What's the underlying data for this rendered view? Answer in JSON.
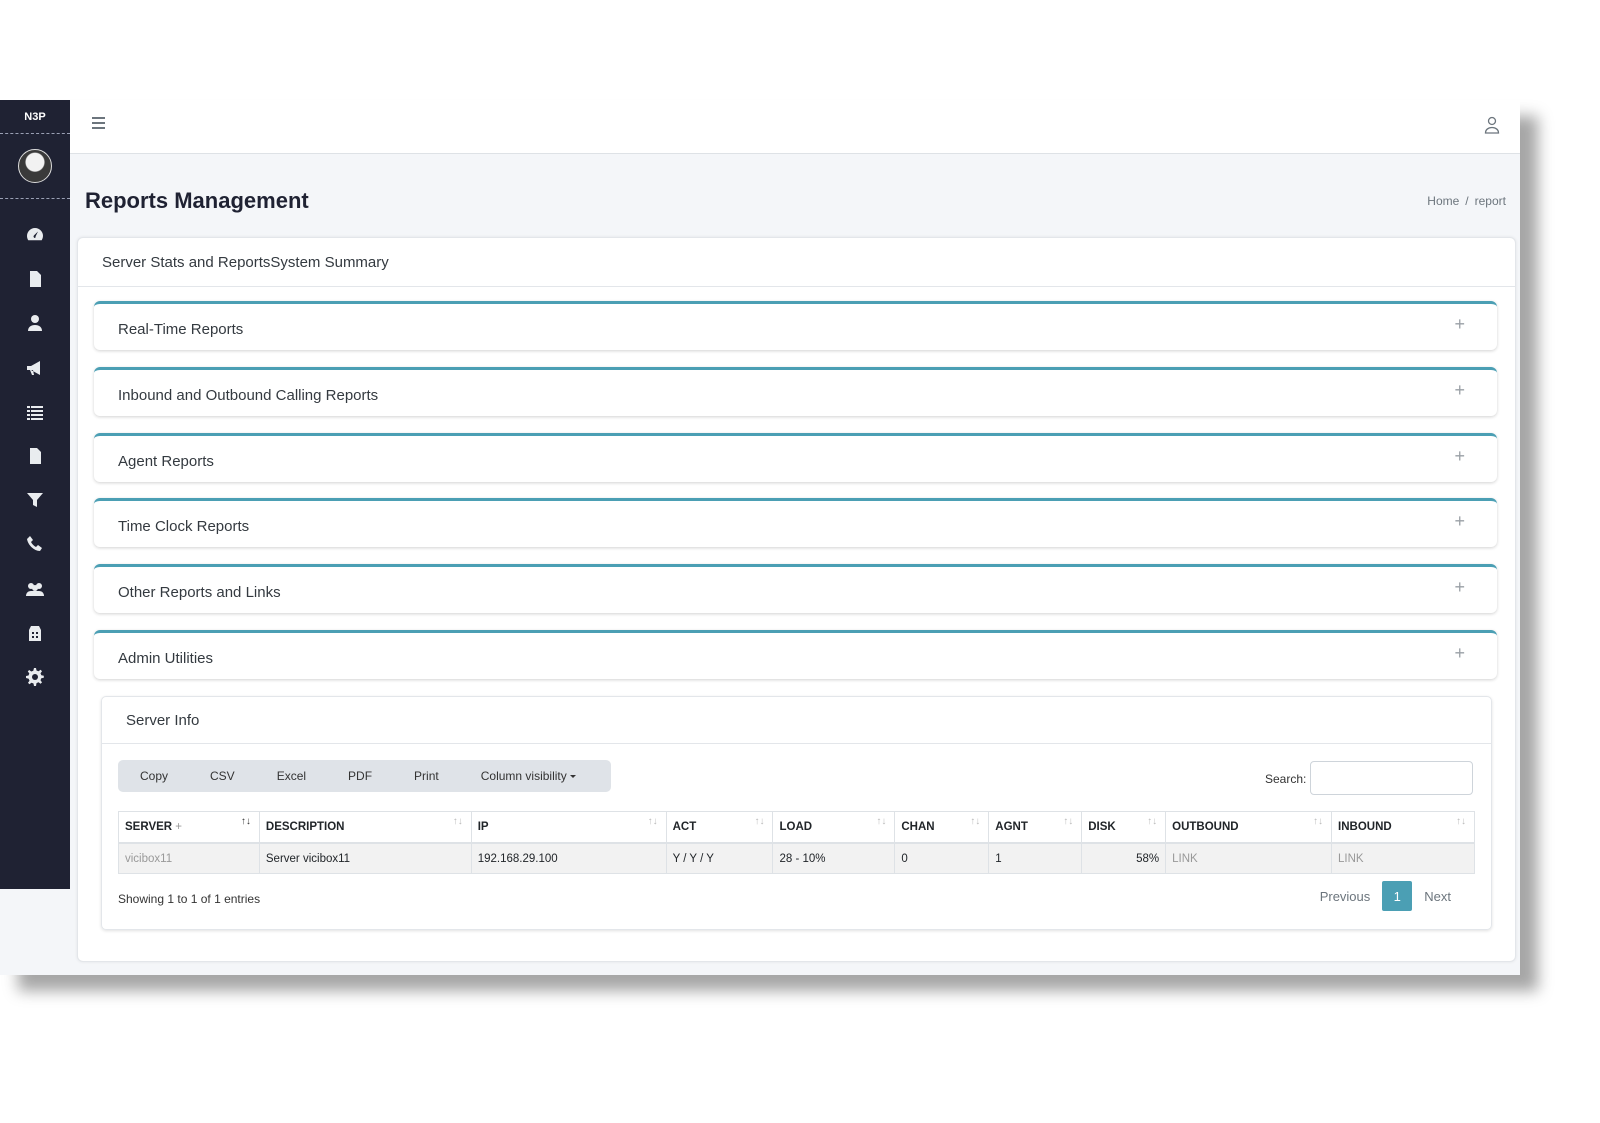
{
  "brand": {
    "logo_text": "N3P"
  },
  "colors": {
    "sidebar": "#1f2233",
    "accent": "#4b9fb4",
    "background": "#f4f6f9"
  },
  "sidebar": {
    "items": [
      {
        "icon": "tachometer-icon"
      },
      {
        "icon": "file-icon"
      },
      {
        "icon": "user-icon"
      },
      {
        "icon": "bullhorn-icon"
      },
      {
        "icon": "list-icon"
      },
      {
        "icon": "file-icon"
      },
      {
        "icon": "filter-icon"
      },
      {
        "icon": "phone-icon"
      },
      {
        "icon": "users-icon"
      },
      {
        "icon": "building-icon"
      },
      {
        "icon": "gear-icon"
      }
    ]
  },
  "header": {
    "title": "Reports Management"
  },
  "breadcrumb": {
    "home": "Home",
    "separator": "/",
    "current": "report"
  },
  "card": {
    "title": "Server Stats and ReportsSystem Summary"
  },
  "accordion": [
    {
      "label": "Real-Time Reports"
    },
    {
      "label": "Inbound and Outbound Calling Reports"
    },
    {
      "label": "Agent Reports"
    },
    {
      "label": "Time Clock Reports"
    },
    {
      "label": "Other Reports and Links"
    },
    {
      "label": "Admin Utilities"
    }
  ],
  "accordion_toggle": "+",
  "server_info": {
    "title": "Server Info",
    "buttons": [
      "Copy",
      "CSV",
      "Excel",
      "PDF",
      "Print"
    ],
    "column_visibility": "Column visibility",
    "search_label": "Search:",
    "search_value": "",
    "columns": [
      "SERVER",
      "DESCRIPTION",
      "IP",
      "ACT",
      "LOAD",
      "CHAN",
      "AGNT",
      "DISK",
      "OUTBOUND",
      "INBOUND"
    ],
    "server_suffix": "+",
    "rows": [
      {
        "server": "vicibox11",
        "description": "Server vicibox11",
        "ip": "192.168.29.100",
        "act": "Y / Y / Y",
        "load": "28 - 10%",
        "chan": "0",
        "agnt": "1",
        "disk": "58%",
        "outbound": "LINK",
        "inbound": "LINK"
      }
    ],
    "info": "Showing 1 to 1 of 1 entries",
    "pagination": {
      "previous": "Previous",
      "page": "1",
      "next": "Next"
    }
  }
}
